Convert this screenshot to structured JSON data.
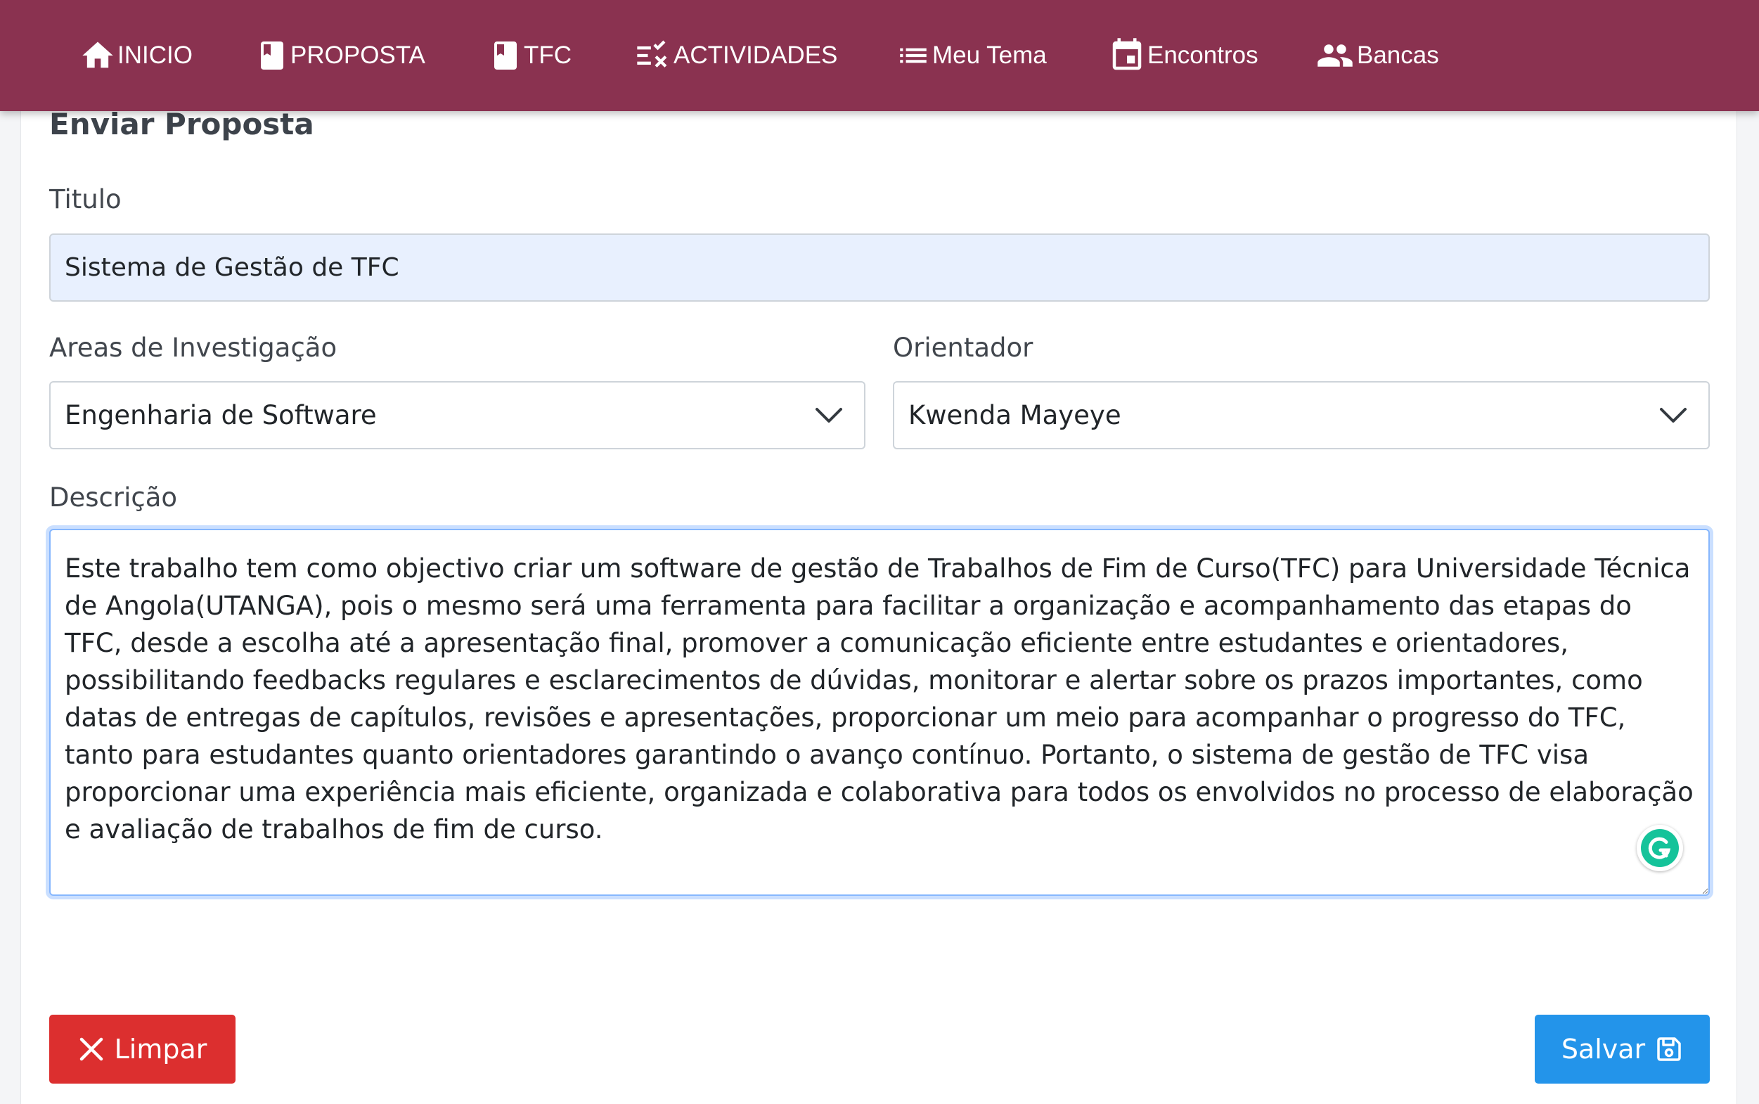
{
  "nav": {
    "items": [
      {
        "label": "INICIO",
        "icon": "home-icon"
      },
      {
        "label": "PROPOSTA",
        "icon": "bookmark-icon"
      },
      {
        "label": "TFC",
        "icon": "bookmark-icon"
      },
      {
        "label": "ACTIVIDADES",
        "icon": "checklist-icon"
      },
      {
        "label": "Meu Tema",
        "icon": "list-icon"
      },
      {
        "label": "Encontros",
        "icon": "calendar-icon"
      },
      {
        "label": "Bancas",
        "icon": "people-icon"
      }
    ]
  },
  "form": {
    "title": "Enviar Proposta",
    "titulo_label": "Titulo",
    "titulo_value": "Sistema de Gestão de TFC",
    "areas_label": "Areas de Investigação",
    "areas_value": "Engenharia de Software",
    "orientador_label": "Orientador",
    "orientador_value": "Kwenda Mayeye",
    "descricao_label": "Descrição",
    "descricao_value": "Este trabalho tem como objectivo criar um software de gestão de Trabalhos de Fim de Curso(TFC) para Universidade Técnica de Angola(UTANGA), pois o mesmo será uma ferramenta para facilitar a organização e acompanhamento das etapas do TFC, desde a escolha até a apresentação final, promover a comunicação eficiente entre estudantes e orientadores, possibilitando feedbacks regulares e esclarecimentos de dúvidas, monitorar e alertar sobre os prazos importantes, como datas de entregas de capítulos, revisões e apresentações, proporcionar um meio para acompanhar o progresso do TFC, tanto para estudantes quanto orientadores garantindo o avanço contínuo. Portanto, o sistema de gestão de TFC visa proporcionar uma experiência mais eficiente, organizada e colaborativa para todos os envolvidos no processo de elaboração e avaliação de trabalhos de fim de curso."
  },
  "actions": {
    "clear_label": "Limpar",
    "clear_icon": "close-icon",
    "save_label": "Salvar",
    "save_icon": "floppy-disk-icon"
  },
  "colors": {
    "navbar": "#8a3250",
    "danger": "#dc2f2f",
    "primary": "#2394ea",
    "autofill": "#e8f0fe",
    "focus_border": "#86b7fe"
  }
}
